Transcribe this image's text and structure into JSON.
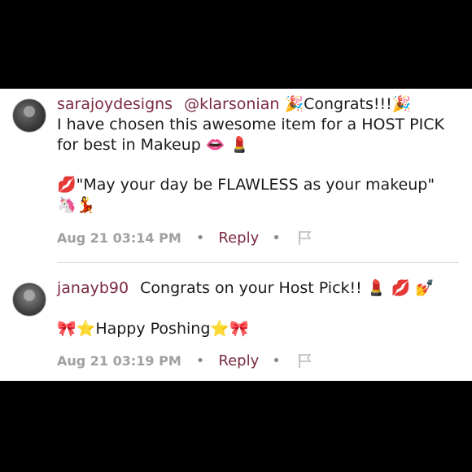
{
  "comments": [
    {
      "username": "sarajoydesigns",
      "mention": "@klarsonian",
      "line1_rest": "🎉Congrats!!!🎉",
      "line2": "I have chosen this awesome item for a HOST PICK",
      "line3": "for best in Makeup 👄 💄",
      "line4": "💋\"May your day be FLAWLESS as your makeup\"",
      "line5": "🦄💃",
      "timestamp": "Aug 21 03:14 PM",
      "reply_label": "Reply"
    },
    {
      "username": "janayb90",
      "line1_rest": "Congrats on your Host Pick!! 💄 💋 💅",
      "line2": "🎀⭐Happy Poshing⭐🎀",
      "timestamp": "Aug 21 03:19 PM",
      "reply_label": "Reply"
    }
  ],
  "icons": {
    "flag": "flag-icon",
    "avatar": "avatar"
  }
}
